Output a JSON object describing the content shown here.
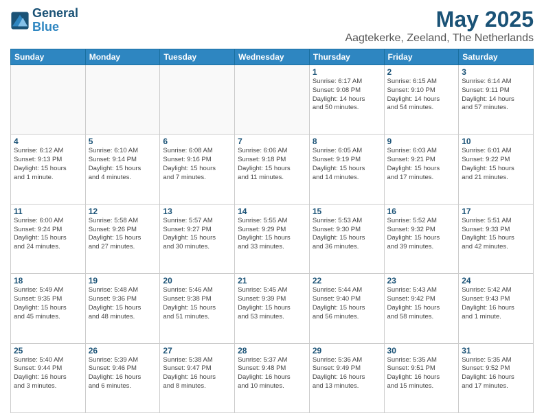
{
  "header": {
    "logo_line1": "General",
    "logo_line2": "Blue",
    "title": "May 2025",
    "subtitle": "Aagtekerke, Zeeland, The Netherlands"
  },
  "weekdays": [
    "Sunday",
    "Monday",
    "Tuesday",
    "Wednesday",
    "Thursday",
    "Friday",
    "Saturday"
  ],
  "weeks": [
    [
      {
        "day": "",
        "info": ""
      },
      {
        "day": "",
        "info": ""
      },
      {
        "day": "",
        "info": ""
      },
      {
        "day": "",
        "info": ""
      },
      {
        "day": "1",
        "info": "Sunrise: 6:17 AM\nSunset: 9:08 PM\nDaylight: 14 hours\nand 50 minutes."
      },
      {
        "day": "2",
        "info": "Sunrise: 6:15 AM\nSunset: 9:10 PM\nDaylight: 14 hours\nand 54 minutes."
      },
      {
        "day": "3",
        "info": "Sunrise: 6:14 AM\nSunset: 9:11 PM\nDaylight: 14 hours\nand 57 minutes."
      }
    ],
    [
      {
        "day": "4",
        "info": "Sunrise: 6:12 AM\nSunset: 9:13 PM\nDaylight: 15 hours\nand 1 minute."
      },
      {
        "day": "5",
        "info": "Sunrise: 6:10 AM\nSunset: 9:14 PM\nDaylight: 15 hours\nand 4 minutes."
      },
      {
        "day": "6",
        "info": "Sunrise: 6:08 AM\nSunset: 9:16 PM\nDaylight: 15 hours\nand 7 minutes."
      },
      {
        "day": "7",
        "info": "Sunrise: 6:06 AM\nSunset: 9:18 PM\nDaylight: 15 hours\nand 11 minutes."
      },
      {
        "day": "8",
        "info": "Sunrise: 6:05 AM\nSunset: 9:19 PM\nDaylight: 15 hours\nand 14 minutes."
      },
      {
        "day": "9",
        "info": "Sunrise: 6:03 AM\nSunset: 9:21 PM\nDaylight: 15 hours\nand 17 minutes."
      },
      {
        "day": "10",
        "info": "Sunrise: 6:01 AM\nSunset: 9:22 PM\nDaylight: 15 hours\nand 21 minutes."
      }
    ],
    [
      {
        "day": "11",
        "info": "Sunrise: 6:00 AM\nSunset: 9:24 PM\nDaylight: 15 hours\nand 24 minutes."
      },
      {
        "day": "12",
        "info": "Sunrise: 5:58 AM\nSunset: 9:26 PM\nDaylight: 15 hours\nand 27 minutes."
      },
      {
        "day": "13",
        "info": "Sunrise: 5:57 AM\nSunset: 9:27 PM\nDaylight: 15 hours\nand 30 minutes."
      },
      {
        "day": "14",
        "info": "Sunrise: 5:55 AM\nSunset: 9:29 PM\nDaylight: 15 hours\nand 33 minutes."
      },
      {
        "day": "15",
        "info": "Sunrise: 5:53 AM\nSunset: 9:30 PM\nDaylight: 15 hours\nand 36 minutes."
      },
      {
        "day": "16",
        "info": "Sunrise: 5:52 AM\nSunset: 9:32 PM\nDaylight: 15 hours\nand 39 minutes."
      },
      {
        "day": "17",
        "info": "Sunrise: 5:51 AM\nSunset: 9:33 PM\nDaylight: 15 hours\nand 42 minutes."
      }
    ],
    [
      {
        "day": "18",
        "info": "Sunrise: 5:49 AM\nSunset: 9:35 PM\nDaylight: 15 hours\nand 45 minutes."
      },
      {
        "day": "19",
        "info": "Sunrise: 5:48 AM\nSunset: 9:36 PM\nDaylight: 15 hours\nand 48 minutes."
      },
      {
        "day": "20",
        "info": "Sunrise: 5:46 AM\nSunset: 9:38 PM\nDaylight: 15 hours\nand 51 minutes."
      },
      {
        "day": "21",
        "info": "Sunrise: 5:45 AM\nSunset: 9:39 PM\nDaylight: 15 hours\nand 53 minutes."
      },
      {
        "day": "22",
        "info": "Sunrise: 5:44 AM\nSunset: 9:40 PM\nDaylight: 15 hours\nand 56 minutes."
      },
      {
        "day": "23",
        "info": "Sunrise: 5:43 AM\nSunset: 9:42 PM\nDaylight: 15 hours\nand 58 minutes."
      },
      {
        "day": "24",
        "info": "Sunrise: 5:42 AM\nSunset: 9:43 PM\nDaylight: 16 hours\nand 1 minute."
      }
    ],
    [
      {
        "day": "25",
        "info": "Sunrise: 5:40 AM\nSunset: 9:44 PM\nDaylight: 16 hours\nand 3 minutes."
      },
      {
        "day": "26",
        "info": "Sunrise: 5:39 AM\nSunset: 9:46 PM\nDaylight: 16 hours\nand 6 minutes."
      },
      {
        "day": "27",
        "info": "Sunrise: 5:38 AM\nSunset: 9:47 PM\nDaylight: 16 hours\nand 8 minutes."
      },
      {
        "day": "28",
        "info": "Sunrise: 5:37 AM\nSunset: 9:48 PM\nDaylight: 16 hours\nand 10 minutes."
      },
      {
        "day": "29",
        "info": "Sunrise: 5:36 AM\nSunset: 9:49 PM\nDaylight: 16 hours\nand 13 minutes."
      },
      {
        "day": "30",
        "info": "Sunrise: 5:35 AM\nSunset: 9:51 PM\nDaylight: 16 hours\nand 15 minutes."
      },
      {
        "day": "31",
        "info": "Sunrise: 5:35 AM\nSunset: 9:52 PM\nDaylight: 16 hours\nand 17 minutes."
      }
    ]
  ]
}
